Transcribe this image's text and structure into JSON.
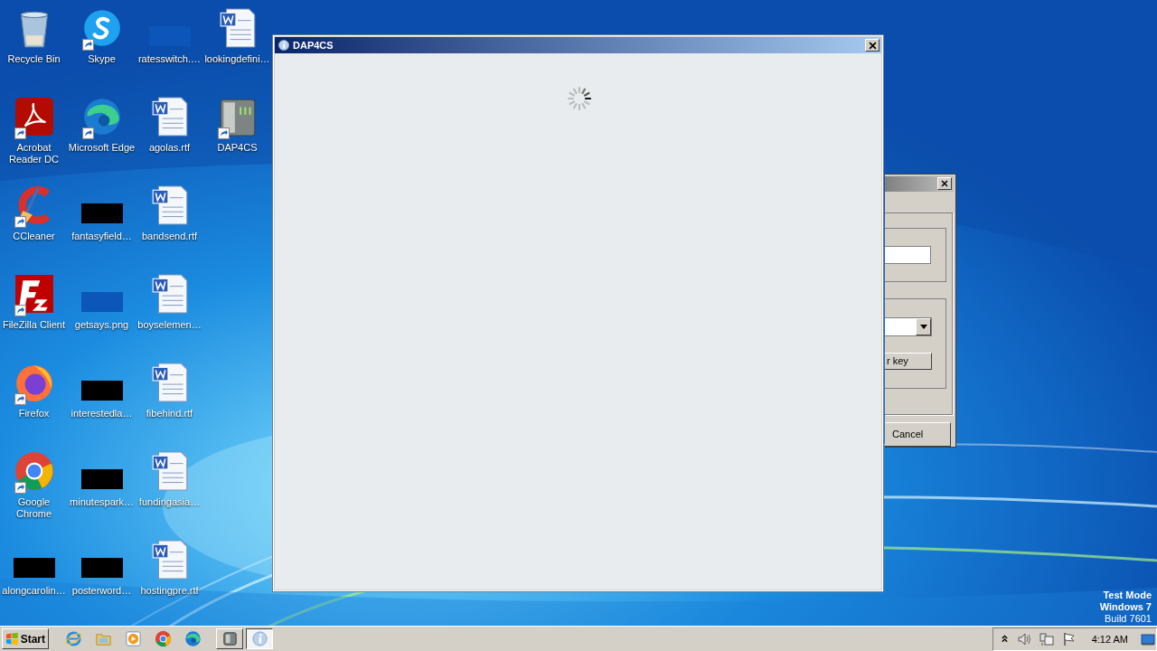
{
  "desktop": {
    "icons": [
      {
        "label": "Recycle Bin",
        "kind": "recycle",
        "shortcut": false
      },
      {
        "label": "Acrobat Reader DC",
        "kind": "acrobat",
        "shortcut": true
      },
      {
        "label": "CCleaner",
        "kind": "ccleaner",
        "shortcut": true
      },
      {
        "label": "FileZilla Client",
        "kind": "filezilla",
        "shortcut": true
      },
      {
        "label": "Firefox",
        "kind": "firefox",
        "shortcut": true
      },
      {
        "label": "Google Chrome",
        "kind": "chrome",
        "shortcut": true
      },
      {
        "label": "alongcarolin…",
        "kind": "dark",
        "shortcut": false
      },
      {
        "label": "Skype",
        "kind": "skype",
        "shortcut": true
      },
      {
        "label": "Microsoft Edge",
        "kind": "edge",
        "shortcut": true
      },
      {
        "label": "fantasyfield…",
        "kind": "dark",
        "shortcut": false
      },
      {
        "label": "getsays.png",
        "kind": "blank",
        "shortcut": false
      },
      {
        "label": "interestedla…",
        "kind": "dark",
        "shortcut": false
      },
      {
        "label": "minutespark…",
        "kind": "dark",
        "shortcut": false
      },
      {
        "label": "posterword…",
        "kind": "dark",
        "shortcut": false
      },
      {
        "label": "ratesswitch.…",
        "kind": "blank",
        "shortcut": false
      },
      {
        "label": "agolas.rtf",
        "kind": "word",
        "shortcut": false
      },
      {
        "label": "bandsend.rtf",
        "kind": "word",
        "shortcut": false
      },
      {
        "label": "boyselemen…",
        "kind": "word",
        "shortcut": false
      },
      {
        "label": "fibehind.rtf",
        "kind": "word",
        "shortcut": false
      },
      {
        "label": "fundingasia…",
        "kind": "word",
        "shortcut": false
      },
      {
        "label": "hostingpre.rtf",
        "kind": "word",
        "shortcut": false
      },
      {
        "label": "lookingdefini…",
        "kind": "word",
        "shortcut": false
      },
      {
        "label": "DAP4CS",
        "kind": "server",
        "shortcut": true
      }
    ],
    "system_text": [
      "Test Mode",
      "Windows 7",
      "Build 7601"
    ]
  },
  "main_window": {
    "title": "DAP4CS",
    "loading": true
  },
  "back_dialog": {
    "buttons": [
      {
        "label": "r key"
      },
      {
        "label": "Cancel"
      }
    ]
  },
  "taskbar": {
    "start_label": "Start",
    "quick_launch": [
      {
        "kind": "ie"
      },
      {
        "kind": "folder"
      },
      {
        "kind": "media"
      },
      {
        "kind": "chrome"
      },
      {
        "kind": "edge"
      }
    ],
    "tasks": [
      {
        "kind": "server",
        "selected": false
      },
      {
        "kind": "info",
        "selected": true
      }
    ],
    "tray": {
      "time": "4:12 AM"
    }
  }
}
